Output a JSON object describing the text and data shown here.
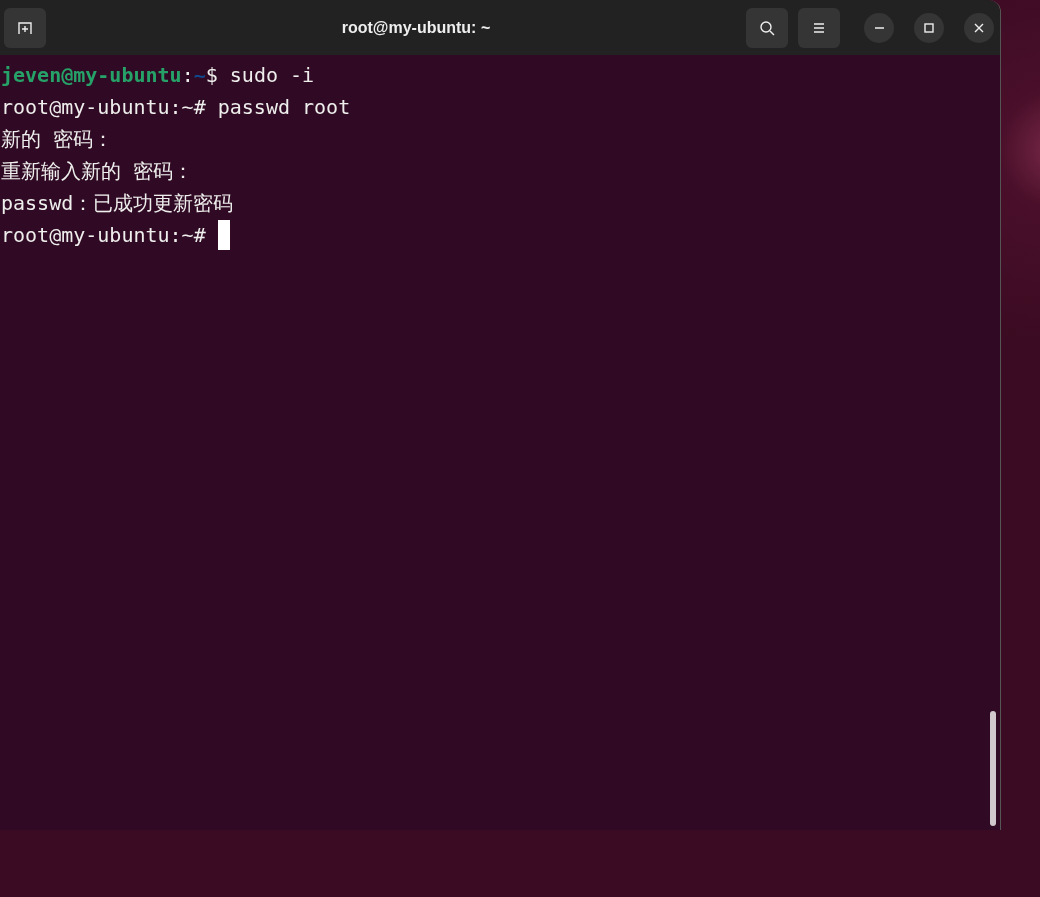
{
  "window": {
    "title": "root@my-ubuntu: ~"
  },
  "terminal": {
    "lines": [
      {
        "cursor": false,
        "segments": [
          {
            "kind": "user",
            "text": "jeven@my-ubuntu"
          },
          {
            "kind": "plain",
            "text": ":"
          },
          {
            "kind": "path",
            "text": "~"
          },
          {
            "kind": "plain",
            "text": "$ sudo -i"
          }
        ]
      },
      {
        "cursor": false,
        "segments": [
          {
            "kind": "plain",
            "text": "root@my-ubuntu:~# passwd root"
          }
        ]
      },
      {
        "cursor": false,
        "segments": [
          {
            "kind": "plain",
            "text": "新的 密码："
          }
        ]
      },
      {
        "cursor": false,
        "segments": [
          {
            "kind": "plain",
            "text": "重新输入新的 密码："
          }
        ]
      },
      {
        "cursor": false,
        "segments": [
          {
            "kind": "plain",
            "text": "passwd：已成功更新密码"
          }
        ]
      },
      {
        "cursor": true,
        "segments": [
          {
            "kind": "plain",
            "text": "root@my-ubuntu:~# "
          }
        ]
      }
    ]
  }
}
